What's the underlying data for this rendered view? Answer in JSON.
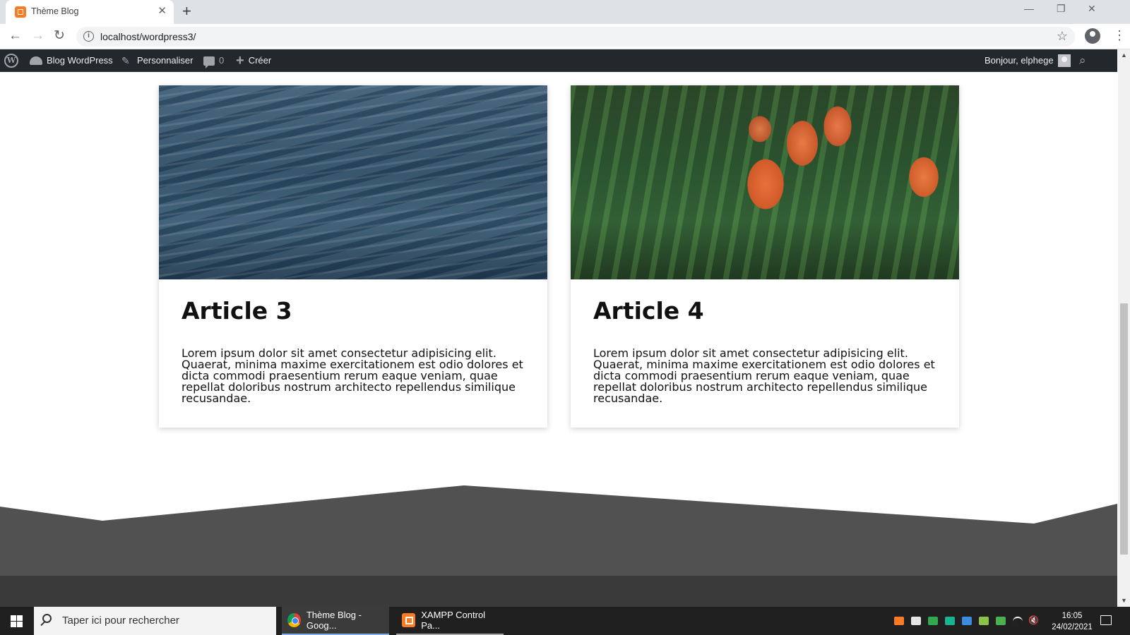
{
  "browser": {
    "tab_title": "Thème Blog",
    "url": "localhost/wordpress3/"
  },
  "adminbar": {
    "site_name": "Blog WordPress",
    "customize": "Personnaliser",
    "comments_count": "0",
    "new": "Créer",
    "greeting": "Bonjour, elphege"
  },
  "articles": [
    {
      "title": "Article 3",
      "image": "water-waves",
      "excerpt": "Lorem ipsum dolor sit amet consectetur adipisicing elit. Quaerat, minima maxime exercitationem est odio dolores et dicta commodi praesentium rerum eaque veniam, quae repellat doloribus nostrum architecto repellendus similique recusandae."
    },
    {
      "title": "Article 4",
      "image": "orange-tulips",
      "excerpt": "Lorem ipsum dolor sit amet consectetur adipisicing elit. Quaerat, minima maxime exercitationem est odio dolores et dicta commodi praesentium rerum eaque veniam, quae repellat doloribus nostrum architecto repellendus similique recusandae."
    }
  ],
  "colors": {
    "footer_top": "#515151",
    "footer_bottom": "#3a3a3a",
    "adminbar_bg": "#23282d"
  },
  "taskbar": {
    "search_placeholder": "Taper ici pour rechercher",
    "apps": [
      {
        "label": "Thème Blog - Goog...",
        "icon": "chrome-icon"
      },
      {
        "label": "XAMPP Control Pa...",
        "icon": "xampp-icon"
      }
    ],
    "time": "16:05",
    "date": "24/02/2021"
  }
}
